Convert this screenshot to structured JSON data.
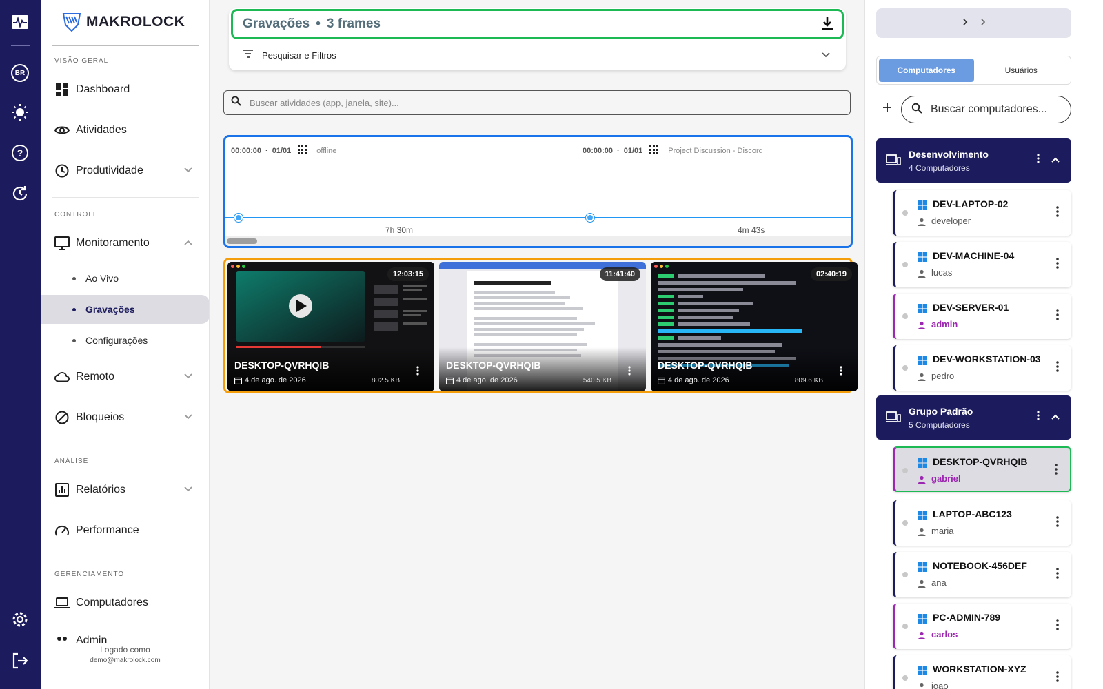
{
  "rail": {
    "lang": "BR",
    "icons": [
      "activity-icon",
      "language-badge",
      "theme-sun-icon",
      "help-icon",
      "refresh-icon",
      "settings-icon",
      "logout-icon"
    ]
  },
  "sidebar": {
    "brand": "MAKROLOCK",
    "sections": {
      "overview": "VISÃO GERAL",
      "control": "CONTROLE",
      "analysis": "ANÁLISE",
      "management": "GERENCIAMENTO"
    },
    "items": {
      "dashboard": "Dashboard",
      "activities": "Atividades",
      "productivity": "Produtividade",
      "monitoring": "Monitoramento",
      "live": "Ao Vivo",
      "recordings": "Gravações",
      "settings": "Configurações",
      "remote": "Remoto",
      "blocks": "Bloqueios",
      "reports": "Relatórios",
      "performance": "Performance",
      "computers": "Computadores",
      "admin": "Admin"
    },
    "logged_as": "Logado como",
    "email": "demo@makrolock.com"
  },
  "main": {
    "title": "Gravações",
    "frames": "3 frames",
    "filters_label": "Pesquisar e Filtros",
    "search_placeholder": "Buscar atividades (app, janela, site)...",
    "timeline": {
      "labels": [
        {
          "time": "00:00:00",
          "date": "01/01",
          "app": "offline"
        },
        {
          "time": "00:00:00",
          "date": "01/01",
          "app": "Project Discussion - Discord"
        }
      ],
      "durations": [
        "7h 30m",
        "4m 43s"
      ]
    },
    "thumbnails": [
      {
        "time": "12:03:15",
        "name": "DESKTOP-QVRHQIB",
        "date": "4 de ago. de 2026",
        "size": "802.5 KB"
      },
      {
        "time": "11:41:40",
        "name": "DESKTOP-QVRHQIB",
        "date": "4 de ago. de 2026",
        "size": "540.5 KB"
      },
      {
        "time": "02:40:19",
        "name": "DESKTOP-QVRHQIB",
        "date": "4 de ago. de 2026",
        "size": "809.6 KB"
      }
    ]
  },
  "right": {
    "tabs": {
      "computers": "Computadores",
      "users": "Usuários"
    },
    "search_placeholder": "Buscar computadores...",
    "groups": [
      {
        "name": "Desenvolvimento",
        "count": "4 Computadores"
      },
      {
        "name": "Grupo Padrão",
        "count": "5 Computadores"
      }
    ],
    "computers": [
      {
        "name": "DEV-LAPTOP-02",
        "user": "developer"
      },
      {
        "name": "DEV-MACHINE-04",
        "user": "lucas"
      },
      {
        "name": "DEV-SERVER-01",
        "user": "admin"
      },
      {
        "name": "DEV-WORKSTATION-03",
        "user": "pedro"
      },
      {
        "name": "DESKTOP-QVRHQIB",
        "user": "gabriel"
      },
      {
        "name": "LAPTOP-ABC123",
        "user": "maria"
      },
      {
        "name": "NOTEBOOK-456DEF",
        "user": "ana"
      },
      {
        "name": "PC-ADMIN-789",
        "user": "carlos"
      },
      {
        "name": "WORKSTATION-XYZ",
        "user": "joao"
      }
    ]
  },
  "colors": {
    "navy": "#1c1b5e",
    "highlight_green": "#1db954",
    "highlight_blue": "#1a73e8",
    "highlight_orange": "#f59e0b",
    "admin_purple": "#9c27b0",
    "tab_active": "#6b9be0"
  }
}
